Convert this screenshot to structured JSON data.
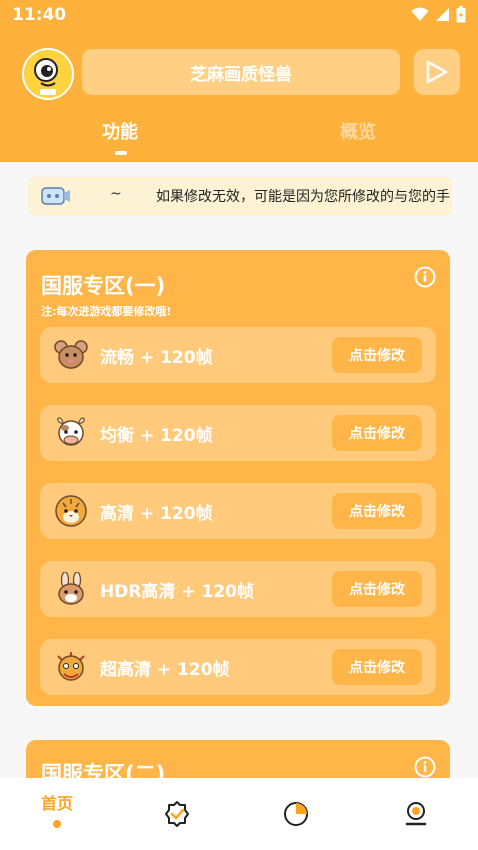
{
  "status": {
    "time": "11:40"
  },
  "header": {
    "title": "芝麻画质怪兽"
  },
  "tabs": [
    {
      "label": "功能"
    },
    {
      "label": "概览"
    }
  ],
  "notice": {
    "tilde": "~",
    "text": "如果修改无效，可能是因为您所修改的与您的手"
  },
  "section1": {
    "title": "国服专区(一)",
    "subtitle": "注:每次进游戏都要修改哦!",
    "rows": [
      {
        "label": "流畅 + 120帧",
        "button": "点击修改",
        "icon": "mouse-icon"
      },
      {
        "label": "均衡 + 120帧",
        "button": "点击修改",
        "icon": "cow-icon"
      },
      {
        "label": "高清 + 120帧",
        "button": "点击修改",
        "icon": "tiger-icon"
      },
      {
        "label": "HDR高清 + 120帧",
        "button": "点击修改",
        "icon": "rabbit-icon"
      },
      {
        "label": "超高清 + 120帧",
        "button": "点击修改",
        "icon": "dragon-icon"
      }
    ]
  },
  "section2": {
    "title": "国服专区(二)"
  },
  "nav": {
    "home_label": "首页"
  },
  "colors": {
    "accent": "#ffb23b",
    "active": "#ffa41f",
    "row": "#ffca7b"
  }
}
